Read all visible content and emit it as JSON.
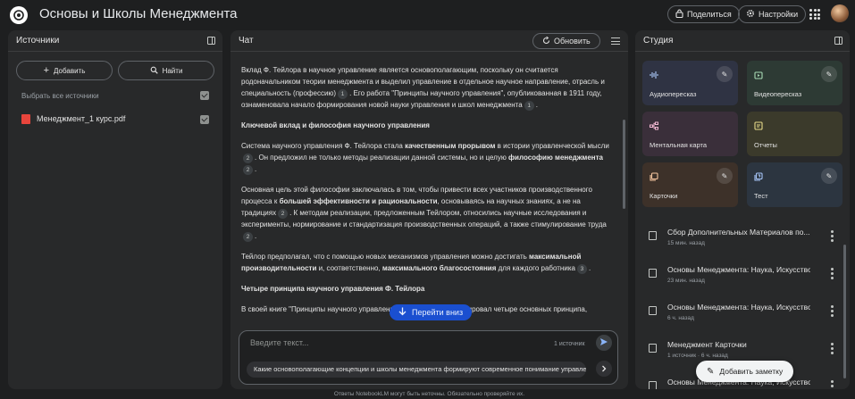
{
  "app": {
    "title": "Основы и Школы Менеджмента",
    "share_label": "Поделиться",
    "settings_label": "Настройки"
  },
  "sources": {
    "header": "Источники",
    "add_label": "Добавить",
    "find_label": "Найти",
    "select_all_label": "Выбрать все источники",
    "items": [
      {
        "name": "Менеджмент_1 курс.pdf",
        "checked": true
      }
    ]
  },
  "chat": {
    "header": "Чат",
    "refresh_label": "Обновить",
    "jump_label": "Перейти вниз",
    "input_placeholder": "Введите текст...",
    "source_count": "1 источник",
    "suggestion": "Какие основополагающие концепции и школы менеджмента формируют современное понимание управления?",
    "disclaimer": "Ответы NotebookLM могут быть неточны. Обязательно проверяйте их.",
    "p1": "Вклад Ф. Тейлора в научное управление является основополагающим, поскольку он считается родоначальником теории менеджмента и выделил управление в отдельное научное направление, отрасль и специальность (профессию)",
    "p1_cite": "1",
    "p1b": ". Его работа \"Принципы научного управления\", опубликованная в 1911 году, ознаменовала начало формирования новой науки управления и школ менеджмента",
    "p1b_cite": "1",
    "h1": "Ключевой вклад и философия научного управления",
    "p2a": "Система научного управления Ф. Тейлора стала ",
    "p2b": "качественным прорывом",
    "p2c": " в истории управленческой мысли",
    "p2_cite": "2",
    "p2d": ". Он предложил не только методы реализации данной системы, но и целую ",
    "p2e": "философию менеджмента",
    "p2_cite2": "2",
    "p3a": "Основная цель этой философии заключалась в том, чтобы привести всех участников производственного процесса к ",
    "p3b": "большей эффективности и рациональности",
    "p3c": ", основываясь на научных знаниях, а не на традициях",
    "p3_cite": "2",
    "p3d": ". К методам реализации, предложенным Тейлором, относились научные исследования и эксперименты, нормирование и стандартизация производственных операций, а также стимулирование труда",
    "p3_cite2": "2",
    "p4a": "Тейлор предполагал, что с помощью новых механизмов управления можно достигать ",
    "p4b": "максимальной производительности",
    "p4c": " и, соответственно, ",
    "p4d": "максимального благосостояния",
    "p4e": " для каждого работника",
    "p4_cite": "3",
    "h2": "Четыре принципа научного управления Ф. Тейлора",
    "p5": "В своей книге \"Принципы научного управления\" Ф. Тейлор сформулировал четыре основных принципа,"
  },
  "studio": {
    "header": "Студия",
    "tiles": [
      {
        "label": "Аудиопересказ",
        "color": "#2f3343",
        "icon": "waveform-icon"
      },
      {
        "label": "Видеопересказ",
        "color": "#2d3a34",
        "icon": "video-icon"
      },
      {
        "label": "Ментальная карта",
        "color": "#3a2f3a",
        "icon": "mindmap-icon"
      },
      {
        "label": "Отчеты",
        "color": "#3b3a2b",
        "icon": "report-icon"
      },
      {
        "label": "Карточки",
        "color": "#3d3129",
        "icon": "cards-icon"
      },
      {
        "label": "Тест",
        "color": "#2c3540",
        "icon": "quiz-icon"
      }
    ],
    "notes": [
      {
        "title": "Сбор Дополнительных Материалов по...",
        "meta": "15 мин. назад"
      },
      {
        "title": "Основы Менеджмента: Наука, Искусство ...",
        "meta": "23 мин. назад"
      },
      {
        "title": "Основы Менеджмента: Наука, Искусство ...",
        "meta": "6 ч. назад"
      },
      {
        "title": "Менеджмент Карточки",
        "meta": "1 источник · 6 ч. назад"
      },
      {
        "title": "Основы Менеджмента: Наука, Искусство ...",
        "meta": ""
      }
    ],
    "add_note_label": "Добавить заметку"
  }
}
